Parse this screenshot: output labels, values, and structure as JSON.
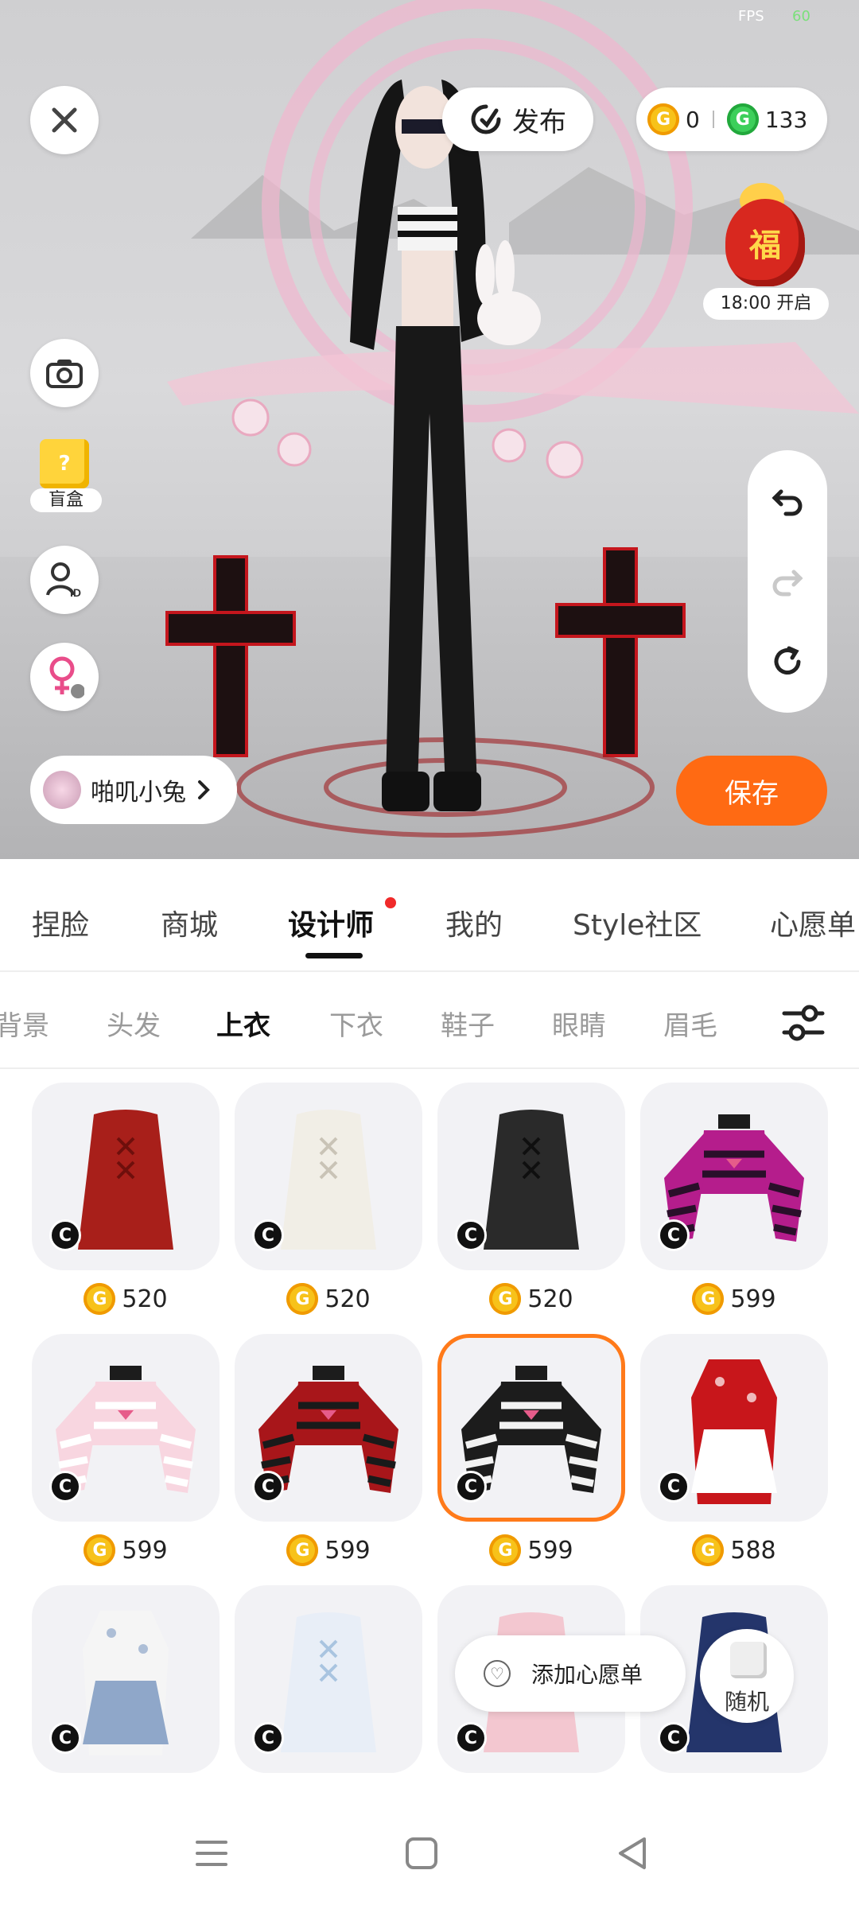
{
  "status": {
    "fps_label": "FPS",
    "fps_value": "60"
  },
  "stage": {
    "publish_label": "发布",
    "currency": {
      "gold_count": "0",
      "green_count": "133"
    },
    "fortune_bag": {
      "char": "福",
      "time_label": "18:00 开启"
    },
    "blind_box_label": "盲盒",
    "creator_name": "啪叽小兔",
    "save_label": "保存"
  },
  "main_tabs": [
    "捏脸",
    "商城",
    "设计师",
    "我的",
    "Style社区",
    "心愿单"
  ],
  "category_tabs": [
    "背景",
    "头发",
    "上衣",
    "下衣",
    "鞋子",
    "眼睛",
    "眉毛"
  ],
  "items": [
    {
      "name": "red-corset-dress",
      "price": "520",
      "color": "#a81f1a",
      "accent": "#6e0f0c",
      "style": "dress"
    },
    {
      "name": "white-corset-dress",
      "price": "520",
      "color": "#f1eee6",
      "accent": "#c9c3b6",
      "style": "dress"
    },
    {
      "name": "black-corset-dress",
      "price": "520",
      "color": "#2a2a2a",
      "accent": "#0f0f0f",
      "style": "dress"
    },
    {
      "name": "pink-striped-crop-top",
      "price": "599",
      "color": "#b51d8c",
      "accent": "#2a0f2a",
      "style": "top"
    },
    {
      "name": "light-pink-crop-top",
      "price": "599",
      "color": "#f8d6e0",
      "accent": "#ffffff",
      "style": "top"
    },
    {
      "name": "red-black-striped-top",
      "price": "599",
      "color": "#a8161a",
      "accent": "#1a1a1a",
      "style": "top"
    },
    {
      "name": "black-white-striped-top",
      "price": "599",
      "color": "#1c1c1c",
      "accent": "#f2f2f2",
      "style": "top",
      "selected": true
    },
    {
      "name": "red-qipao-maid",
      "price": "588",
      "color": "#c8161b",
      "accent": "#ffffff",
      "style": "qipao"
    },
    {
      "name": "white-blue-qipao",
      "price": "",
      "color": "#f5f5f5",
      "accent": "#8fa7c9",
      "style": "qipao"
    },
    {
      "name": "white-blouse-blue-skirt",
      "price": "",
      "color": "#e8eef7",
      "accent": "#a9c4e0",
      "style": "dress"
    },
    {
      "name": "pink-skirt",
      "price": "",
      "color": "#f3c7d0",
      "accent": "#ffffff",
      "style": "dress"
    },
    {
      "name": "navy-outfit",
      "price": "",
      "color": "#24356b",
      "accent": "#ffffff",
      "style": "dress"
    }
  ],
  "wishlist_label": "添加心愿单",
  "random_label": "随机",
  "colors": {
    "accent_orange": "#ff6a13",
    "selected_border": "#ff7a1a",
    "gold_coin": "#f7c21a",
    "green_coin": "#3ccf5a"
  }
}
